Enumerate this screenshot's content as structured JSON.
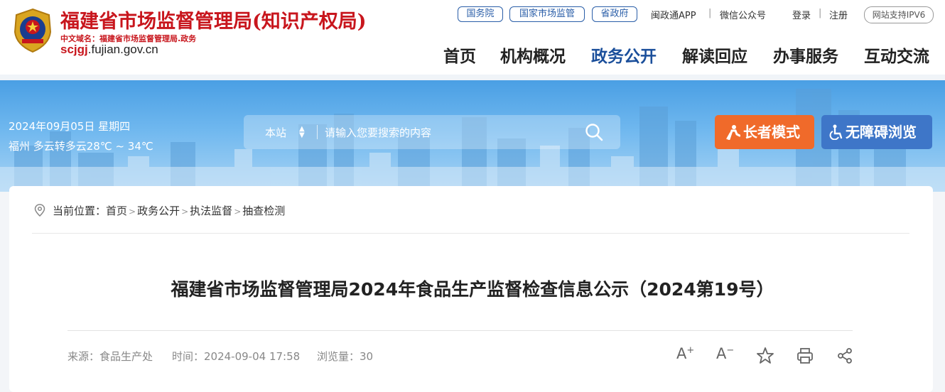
{
  "header": {
    "site_title": "福建省市场监督管理局(知识产权局)",
    "cn_domain": "中文域名：福建省市场监督管理局.政务",
    "en_domain_strong": "scjgj",
    "en_domain_rest": ".fujian.gov.cn",
    "top_links": {
      "guowuyuan": "国务院",
      "guojia": "国家市场监管",
      "shengzhengfu": "省政府",
      "minzhengtong": "闽政通APP",
      "wechat": "微信公众号",
      "login": "登录",
      "register": "注册",
      "ipv6": "网站支持IPV6"
    },
    "nav": [
      "首页",
      "机构概况",
      "政务公开",
      "解读回应",
      "办事服务",
      "互动交流"
    ],
    "nav_active_index": 2
  },
  "banner": {
    "date": "2024年09月05日 星期四",
    "weather": "福州 多云转多云28℃ ~ 34℃",
    "search": {
      "scope": "本站",
      "placeholder": "请输入您要搜索的内容"
    },
    "elder_mode": "长者模式",
    "accessibility": "无障碍浏览"
  },
  "breadcrumb": {
    "prefix": "当前位置：",
    "items": [
      "首页",
      "政务公开",
      "执法监督",
      "抽查检测"
    ]
  },
  "article": {
    "title": "福建省市场监督管理局2024年食品生产监督检查信息公示（2024第19号）",
    "source": "来源：食品生产处",
    "time": "时间：2024-09-04 17:58",
    "views": "浏览量：30"
  },
  "colors": {
    "brand_red": "#c8161d",
    "nav_active": "#1b4f9b",
    "elder_button": "#f06a2a",
    "access_button": "#3e76c8"
  }
}
